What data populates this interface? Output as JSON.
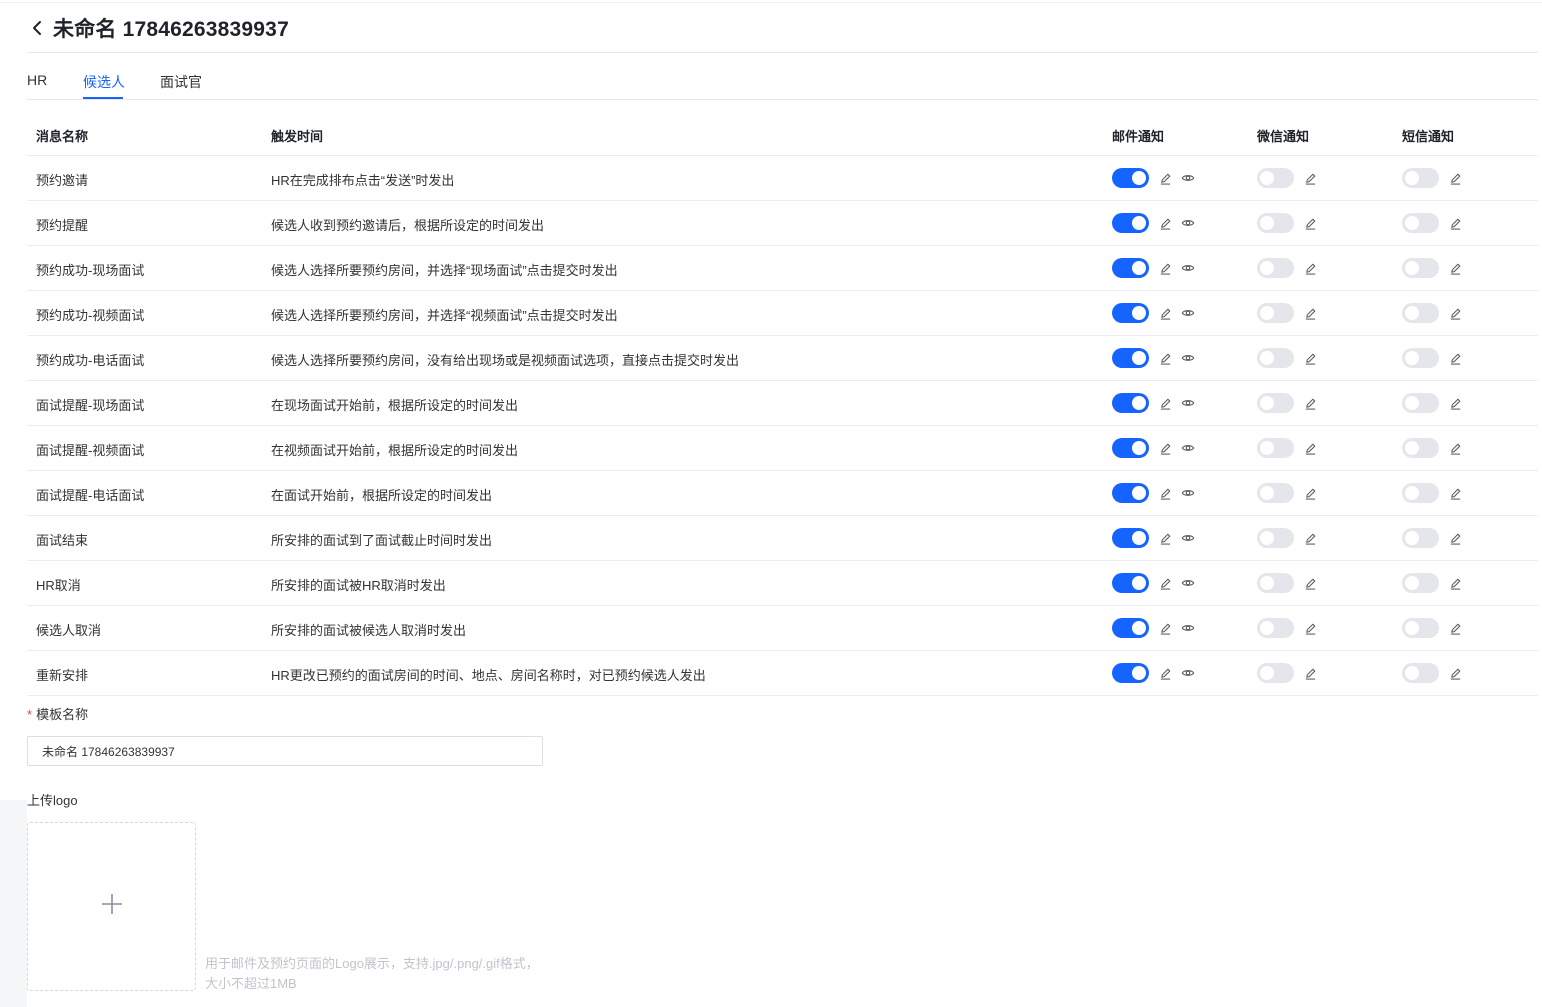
{
  "header": {
    "title": "未命名 17846263839937"
  },
  "tabs": [
    {
      "label": "HR"
    },
    {
      "label": "候选人",
      "active": true
    },
    {
      "label": "面试官"
    }
  ],
  "table": {
    "columns": {
      "name": "消息名称",
      "trigger": "触发时间",
      "email": "邮件通知",
      "wechat": "微信通知",
      "sms": "短信通知"
    },
    "rows": [
      {
        "name": "预约邀请",
        "trigger": "HR在完成排布点击“发送”时发出",
        "email": true,
        "wechat": false,
        "sms": false
      },
      {
        "name": "预约提醒",
        "trigger": "候选人收到预约邀请后，根据所设定的时间发出",
        "email": true,
        "wechat": false,
        "sms": false
      },
      {
        "name": "预约成功-现场面试",
        "trigger": "候选人选择所要预约房间，并选择“现场面试”点击提交时发出",
        "email": true,
        "wechat": false,
        "sms": false
      },
      {
        "name": "预约成功-视频面试",
        "trigger": "候选人选择所要预约房间，并选择“视频面试”点击提交时发出",
        "email": true,
        "wechat": false,
        "sms": false
      },
      {
        "name": "预约成功-电话面试",
        "trigger": "候选人选择所要预约房间，没有给出现场或是视频面试选项，直接点击提交时发出",
        "email": true,
        "wechat": false,
        "sms": false
      },
      {
        "name": "面试提醒-现场面试",
        "trigger": "在现场面试开始前，根据所设定的时间发出",
        "email": true,
        "wechat": false,
        "sms": false
      },
      {
        "name": "面试提醒-视频面试",
        "trigger": "在视频面试开始前，根据所设定的时间发出",
        "email": true,
        "wechat": false,
        "sms": false
      },
      {
        "name": "面试提醒-电话面试",
        "trigger": "在面试开始前，根据所设定的时间发出",
        "email": true,
        "wechat": false,
        "sms": false
      },
      {
        "name": "面试结束",
        "trigger": "所安排的面试到了面试截止时间时发出",
        "email": true,
        "wechat": false,
        "sms": false
      },
      {
        "name": "HR取消",
        "trigger": "所安排的面试被HR取消时发出",
        "email": true,
        "wechat": false,
        "sms": false
      },
      {
        "name": "候选人取消",
        "trigger": "所安排的面试被候选人取消时发出",
        "email": true,
        "wechat": false,
        "sms": false
      },
      {
        "name": "重新安排",
        "trigger": "HR更改已预约的面试房间的时间、地点、房间名称时，对已预约候选人发出",
        "email": true,
        "wechat": false,
        "sms": false
      }
    ]
  },
  "form": {
    "required_mark": "*",
    "template_name_label": "模板名称",
    "template_name_value": "未命名 17846263839937",
    "upload_label": "上传logo",
    "upload_hint": "用于邮件及预约页面的Logo展示，支持.jpg/.png/.gif格式，大小不超过1MB"
  },
  "icons": {
    "back": "chevron-left-icon",
    "edit": "pencil-icon",
    "preview": "eye-icon",
    "upload": "plus-icon"
  },
  "colors": {
    "accent": "#1664ff",
    "switch_off": "#e4e6eb",
    "required": "#f53f3f",
    "hint": "#c0c4cc"
  }
}
